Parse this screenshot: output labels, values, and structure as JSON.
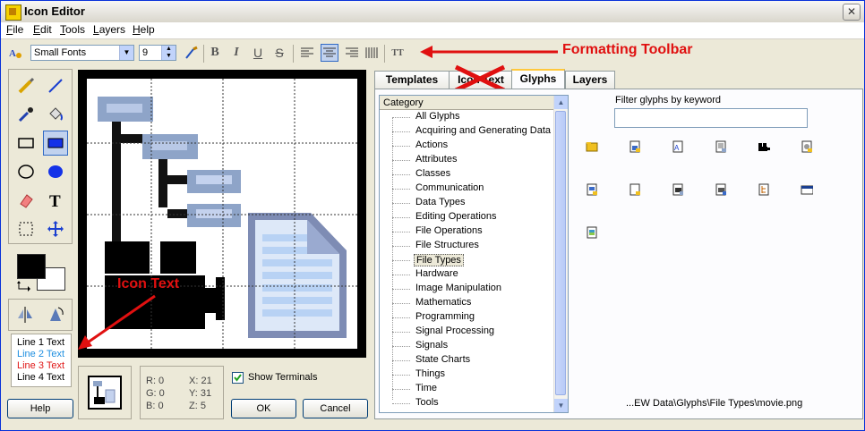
{
  "window": {
    "title": "Icon Editor",
    "close_glyph": "✕"
  },
  "menu": [
    {
      "label": "File",
      "underline": "F",
      "rest": "ile"
    },
    {
      "label": "Edit",
      "underline": "E",
      "rest": "dit"
    },
    {
      "label": "Tools",
      "underline": "T",
      "rest": "ools"
    },
    {
      "label": "Layers",
      "underline": "L",
      "rest": "ayers"
    },
    {
      "label": "Help",
      "underline": "H",
      "rest": "elp"
    }
  ],
  "toolbar": {
    "font_name": "Small Fonts",
    "font_size": "9",
    "bold": "B",
    "italic": "I",
    "underline": "U",
    "strike": "S",
    "text_tool": "TT"
  },
  "annotations": {
    "formatting_toolbar": "Formatting Toolbar",
    "icon_text": "Icon Text"
  },
  "icon_text_lines": [
    {
      "text": "Line 1 Text",
      "color": "#000000"
    },
    {
      "text": "Line 2 Text",
      "color": "#1f8fe0"
    },
    {
      "text": "Line 3 Text",
      "color": "#e01818"
    },
    {
      "text": "Line 4 Text",
      "color": "#000000"
    }
  ],
  "coords": {
    "r": "R: 0",
    "g": "G: 0",
    "b": "B: 0",
    "x": "X: 21",
    "y": "Y: 31",
    "z": "Z: 5"
  },
  "show_terminals": {
    "label": "Show Terminals",
    "checked": true
  },
  "buttons": {
    "help": "Help",
    "ok": "OK",
    "cancel": "Cancel"
  },
  "tabs": [
    "Templates",
    "Icon Text",
    "Glyphs",
    "Layers"
  ],
  "tab_obscured_label": "Icon Text",
  "active_tab": "Glyphs",
  "category": {
    "header": "Category",
    "items": [
      "All Glyphs",
      "Acquiring and Generating Data",
      "Actions",
      "Attributes",
      "Classes",
      "Communication",
      "Data Types",
      "Editing Operations",
      "File Operations",
      "File Structures",
      "File Types",
      "Hardware",
      "Image Manipulation",
      "Mathematics",
      "Programming",
      "Signal Processing",
      "Signals",
      "State Charts",
      "Things",
      "Time",
      "Tools"
    ],
    "selected": "File Types"
  },
  "filter": {
    "label": "Filter glyphs by keyword",
    "value": ""
  },
  "glyph_path": "...EW Data\\Glyphs\\File Types\\movie.png",
  "colors": {
    "accent": "#316ac5",
    "annotation": "#e01010",
    "tab_highlight": "#ffc83c"
  }
}
